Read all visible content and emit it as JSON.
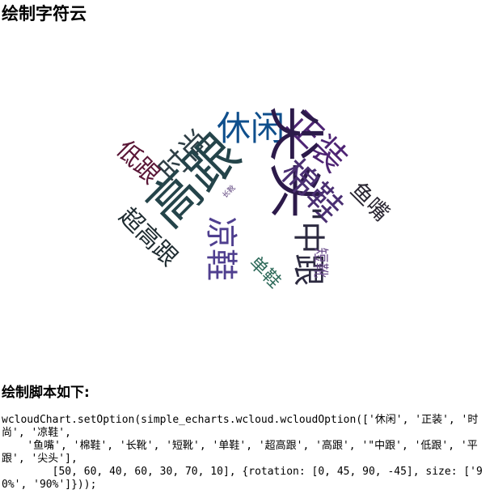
{
  "page": {
    "title": "绘制字符云",
    "script_heading": "绘制脚本如下:",
    "code": "wcloudChart.setOption(simple_echarts.wcloud.wcloudOption(['休闲', '正装', '时尚', '凉鞋',\n    '鱼嘴', '棉鞋', '长靴', '短靴', '单鞋', '超高跟', '高跟', '\"中跟', '低跟', '平跟', '尖头'],\n        [50, 60, 40, 60, 30, 70, 10], {rotation: [0, 45, 90, -45], size: ['90%', '90%']}));"
  },
  "cloud": {
    "words": [
      {
        "text": "休闲",
        "color": "#0f4f8c"
      },
      {
        "text": "正装",
        "color": "#4e2474"
      },
      {
        "text": "时尚",
        "color": "#2f3f46"
      },
      {
        "text": "高跟",
        "color": "#24444a"
      },
      {
        "text": "尖头",
        "color": "#2c1a4a"
      },
      {
        "text": "棉鞋",
        "color": "#4a2f72"
      },
      {
        "text": "低跟",
        "color": "#5a1636"
      },
      {
        "text": "超高跟",
        "color": "#1e2b30"
      },
      {
        "text": "凉鞋",
        "color": "#4f3f8f"
      },
      {
        "text": "\"中跟",
        "color": "#2c2a40"
      },
      {
        "text": "鱼嘴",
        "color": "#2a2632"
      },
      {
        "text": "短靴",
        "color": "#6a4c8a"
      },
      {
        "text": "单鞋",
        "color": "#2e6a5a"
      },
      {
        "text": "长靴",
        "color": "#5a3f7a"
      }
    ]
  }
}
